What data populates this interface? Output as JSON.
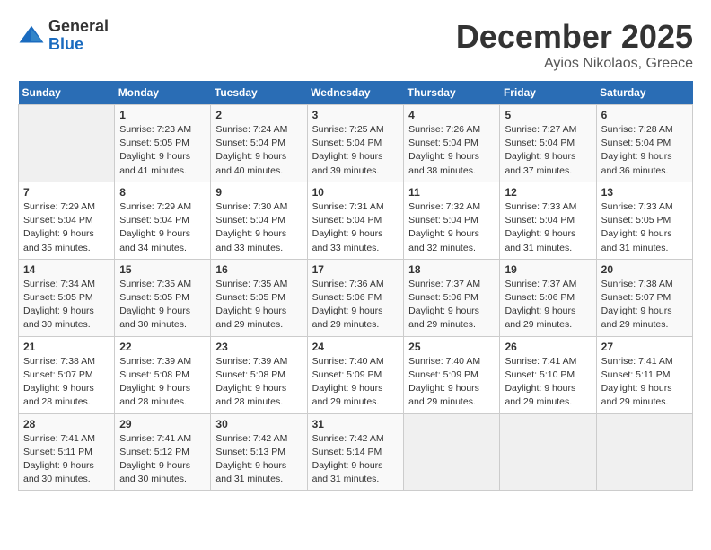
{
  "header": {
    "logo_line1": "General",
    "logo_line2": "Blue",
    "month": "December 2025",
    "location": "Ayios Nikolaos, Greece"
  },
  "weekdays": [
    "Sunday",
    "Monday",
    "Tuesday",
    "Wednesday",
    "Thursday",
    "Friday",
    "Saturday"
  ],
  "weeks": [
    [
      {
        "day": "",
        "info": ""
      },
      {
        "day": "1",
        "info": "Sunrise: 7:23 AM\nSunset: 5:05 PM\nDaylight: 9 hours\nand 41 minutes."
      },
      {
        "day": "2",
        "info": "Sunrise: 7:24 AM\nSunset: 5:04 PM\nDaylight: 9 hours\nand 40 minutes."
      },
      {
        "day": "3",
        "info": "Sunrise: 7:25 AM\nSunset: 5:04 PM\nDaylight: 9 hours\nand 39 minutes."
      },
      {
        "day": "4",
        "info": "Sunrise: 7:26 AM\nSunset: 5:04 PM\nDaylight: 9 hours\nand 38 minutes."
      },
      {
        "day": "5",
        "info": "Sunrise: 7:27 AM\nSunset: 5:04 PM\nDaylight: 9 hours\nand 37 minutes."
      },
      {
        "day": "6",
        "info": "Sunrise: 7:28 AM\nSunset: 5:04 PM\nDaylight: 9 hours\nand 36 minutes."
      }
    ],
    [
      {
        "day": "7",
        "info": "Sunrise: 7:29 AM\nSunset: 5:04 PM\nDaylight: 9 hours\nand 35 minutes."
      },
      {
        "day": "8",
        "info": "Sunrise: 7:29 AM\nSunset: 5:04 PM\nDaylight: 9 hours\nand 34 minutes."
      },
      {
        "day": "9",
        "info": "Sunrise: 7:30 AM\nSunset: 5:04 PM\nDaylight: 9 hours\nand 33 minutes."
      },
      {
        "day": "10",
        "info": "Sunrise: 7:31 AM\nSunset: 5:04 PM\nDaylight: 9 hours\nand 33 minutes."
      },
      {
        "day": "11",
        "info": "Sunrise: 7:32 AM\nSunset: 5:04 PM\nDaylight: 9 hours\nand 32 minutes."
      },
      {
        "day": "12",
        "info": "Sunrise: 7:33 AM\nSunset: 5:04 PM\nDaylight: 9 hours\nand 31 minutes."
      },
      {
        "day": "13",
        "info": "Sunrise: 7:33 AM\nSunset: 5:05 PM\nDaylight: 9 hours\nand 31 minutes."
      }
    ],
    [
      {
        "day": "14",
        "info": "Sunrise: 7:34 AM\nSunset: 5:05 PM\nDaylight: 9 hours\nand 30 minutes."
      },
      {
        "day": "15",
        "info": "Sunrise: 7:35 AM\nSunset: 5:05 PM\nDaylight: 9 hours\nand 30 minutes."
      },
      {
        "day": "16",
        "info": "Sunrise: 7:35 AM\nSunset: 5:05 PM\nDaylight: 9 hours\nand 29 minutes."
      },
      {
        "day": "17",
        "info": "Sunrise: 7:36 AM\nSunset: 5:06 PM\nDaylight: 9 hours\nand 29 minutes."
      },
      {
        "day": "18",
        "info": "Sunrise: 7:37 AM\nSunset: 5:06 PM\nDaylight: 9 hours\nand 29 minutes."
      },
      {
        "day": "19",
        "info": "Sunrise: 7:37 AM\nSunset: 5:06 PM\nDaylight: 9 hours\nand 29 minutes."
      },
      {
        "day": "20",
        "info": "Sunrise: 7:38 AM\nSunset: 5:07 PM\nDaylight: 9 hours\nand 29 minutes."
      }
    ],
    [
      {
        "day": "21",
        "info": "Sunrise: 7:38 AM\nSunset: 5:07 PM\nDaylight: 9 hours\nand 28 minutes."
      },
      {
        "day": "22",
        "info": "Sunrise: 7:39 AM\nSunset: 5:08 PM\nDaylight: 9 hours\nand 28 minutes."
      },
      {
        "day": "23",
        "info": "Sunrise: 7:39 AM\nSunset: 5:08 PM\nDaylight: 9 hours\nand 28 minutes."
      },
      {
        "day": "24",
        "info": "Sunrise: 7:40 AM\nSunset: 5:09 PM\nDaylight: 9 hours\nand 29 minutes."
      },
      {
        "day": "25",
        "info": "Sunrise: 7:40 AM\nSunset: 5:09 PM\nDaylight: 9 hours\nand 29 minutes."
      },
      {
        "day": "26",
        "info": "Sunrise: 7:41 AM\nSunset: 5:10 PM\nDaylight: 9 hours\nand 29 minutes."
      },
      {
        "day": "27",
        "info": "Sunrise: 7:41 AM\nSunset: 5:11 PM\nDaylight: 9 hours\nand 29 minutes."
      }
    ],
    [
      {
        "day": "28",
        "info": "Sunrise: 7:41 AM\nSunset: 5:11 PM\nDaylight: 9 hours\nand 30 minutes."
      },
      {
        "day": "29",
        "info": "Sunrise: 7:41 AM\nSunset: 5:12 PM\nDaylight: 9 hours\nand 30 minutes."
      },
      {
        "day": "30",
        "info": "Sunrise: 7:42 AM\nSunset: 5:13 PM\nDaylight: 9 hours\nand 31 minutes."
      },
      {
        "day": "31",
        "info": "Sunrise: 7:42 AM\nSunset: 5:14 PM\nDaylight: 9 hours\nand 31 minutes."
      },
      {
        "day": "",
        "info": ""
      },
      {
        "day": "",
        "info": ""
      },
      {
        "day": "",
        "info": ""
      }
    ]
  ]
}
